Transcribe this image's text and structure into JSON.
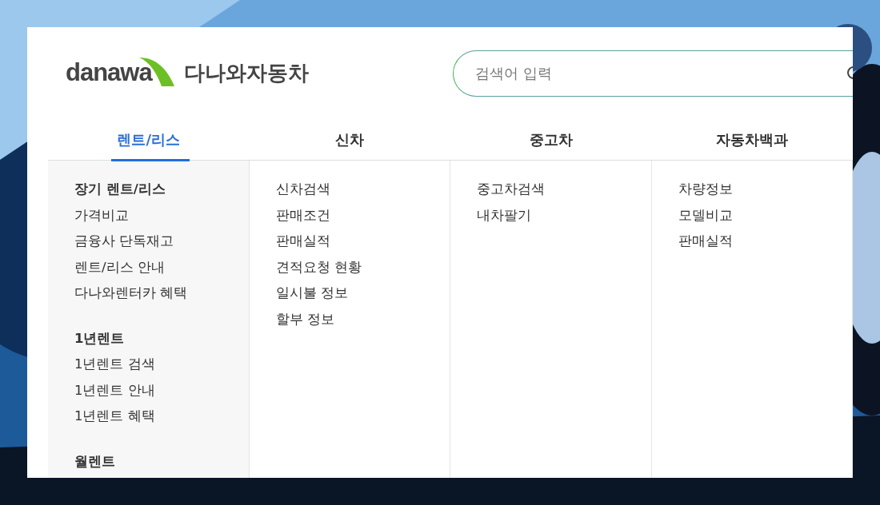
{
  "logo": {
    "wordmark": "danawa",
    "title": "다나와자동차"
  },
  "search": {
    "placeholder": "검색어 입력"
  },
  "tabs": [
    {
      "label": "렌트/리스",
      "selected": true,
      "items": [
        {
          "kind": "heading",
          "label": "장기 렌트/리스"
        },
        {
          "kind": "link",
          "label": "가격비교"
        },
        {
          "kind": "link",
          "label": "금융사 단독재고"
        },
        {
          "kind": "link",
          "label": "렌트/리스 안내"
        },
        {
          "kind": "link",
          "label": "다나와렌터카 혜택"
        },
        {
          "kind": "heading",
          "label": "1년렌트"
        },
        {
          "kind": "link",
          "label": "1년렌트 검색"
        },
        {
          "kind": "link",
          "label": "1년렌트 안내"
        },
        {
          "kind": "link",
          "label": "1년렌트 혜택"
        },
        {
          "kind": "heading",
          "label": "월렌트"
        }
      ]
    },
    {
      "label": "신차",
      "selected": false,
      "items": [
        {
          "kind": "link",
          "label": "신차검색"
        },
        {
          "kind": "link",
          "label": "판매조건"
        },
        {
          "kind": "link",
          "label": "판매실적"
        },
        {
          "kind": "link",
          "label": "견적요청 현황"
        },
        {
          "kind": "link",
          "label": "일시불 정보"
        },
        {
          "kind": "link",
          "label": "할부 정보"
        }
      ]
    },
    {
      "label": "중고차",
      "selected": false,
      "items": [
        {
          "kind": "link",
          "label": "중고차검색"
        },
        {
          "kind": "link",
          "label": "내차팔기"
        }
      ]
    },
    {
      "label": "자동차백과",
      "selected": false,
      "items": [
        {
          "kind": "link",
          "label": "차량정보"
        },
        {
          "kind": "link",
          "label": "모델비교"
        },
        {
          "kind": "link",
          "label": "판매실적"
        }
      ]
    }
  ]
}
